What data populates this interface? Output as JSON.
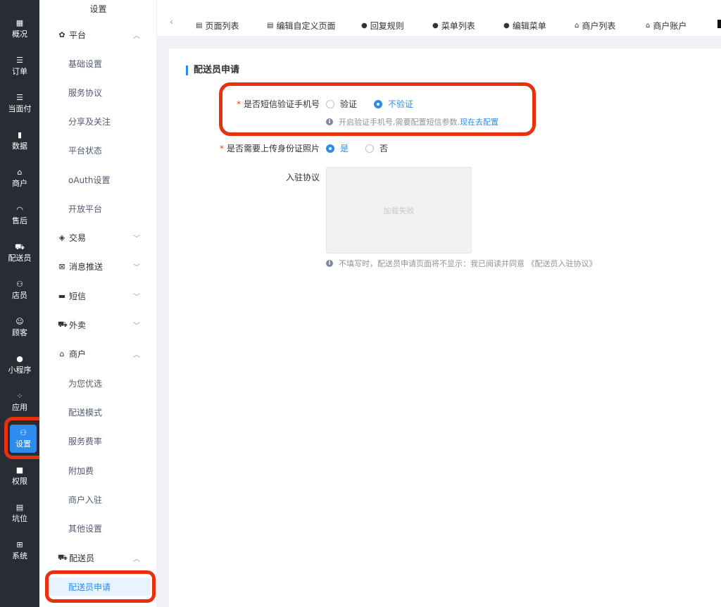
{
  "rail": {
    "items": [
      {
        "label": "概况",
        "icon": "▦"
      },
      {
        "label": "订单",
        "icon": "☰"
      },
      {
        "label": "当面付",
        "icon": "☰"
      },
      {
        "label": "数据",
        "icon": "▮"
      },
      {
        "label": "商户",
        "icon": "⌂"
      },
      {
        "label": "售后",
        "icon": "◠"
      },
      {
        "label": "配送员",
        "icon": "⛟"
      },
      {
        "label": "店员",
        "icon": "⚇"
      },
      {
        "label": "顾客",
        "icon": "☺"
      },
      {
        "label": "小程序",
        "icon": "●"
      },
      {
        "label": "应用",
        "icon": "⁘"
      },
      {
        "label": "设置",
        "icon": "⚇"
      },
      {
        "label": "权限",
        "icon": "■"
      },
      {
        "label": "坑位",
        "icon": "▤"
      },
      {
        "label": "系统",
        "icon": "⊞"
      }
    ]
  },
  "subnav": {
    "title": "设置",
    "platform": {
      "label": "平台",
      "items": [
        "基础设置",
        "服务协议",
        "分享及关注",
        "平台状态",
        "oAuth设置",
        "开放平台"
      ]
    },
    "trade": {
      "label": "交易"
    },
    "push": {
      "label": "消息推送"
    },
    "sms": {
      "label": "短信"
    },
    "takeout": {
      "label": "外卖"
    },
    "merchant": {
      "label": "商户",
      "items": [
        "为您优选",
        "配送模式",
        "服务费率",
        "附加费",
        "商户入驻",
        "其他设置"
      ]
    },
    "courier": {
      "label": "配送员",
      "active_item": "配送员申请"
    }
  },
  "topbar": {
    "back": "‹",
    "tabs": [
      "页面列表",
      "编辑自定义页面",
      "回复规则",
      "菜单列表",
      "编辑菜单",
      "商户列表",
      "商户账户"
    ]
  },
  "form": {
    "title": "配送员申请",
    "sms_verify": {
      "label": "是否短信验证手机号",
      "required": "*",
      "option_yes": "验证",
      "option_no": "不验证",
      "selected": "不验证",
      "hint": "开启验证手机号,需要配置短信参数.",
      "hint_link": "现在去配置"
    },
    "id_photo": {
      "label": "是否需要上传身份证照片",
      "required": "*",
      "option_yes": "是",
      "option_no": "否",
      "selected": "是"
    },
    "agreement": {
      "label": "入驻协议",
      "image_text": "加载失败",
      "hint": "不填写时，配送员申请页面将不显示：我已阅读并同意 《配送员入驻协议》"
    }
  },
  "colors": {
    "accent": "#2d8cf0",
    "highlight": "#e8320f",
    "rail_bg": "#282c34"
  }
}
